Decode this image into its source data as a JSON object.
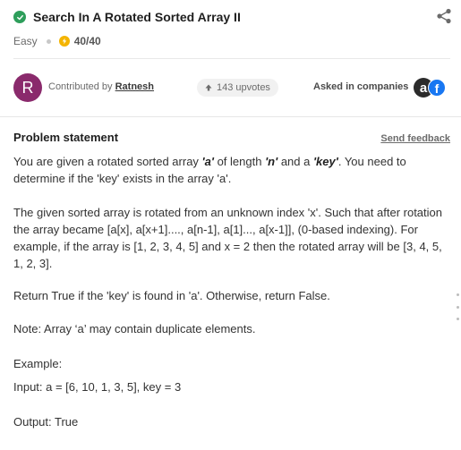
{
  "problem": {
    "title": "Search In A Rotated Sorted Array II",
    "difficulty": "Easy",
    "score": "40/40"
  },
  "contributor": {
    "avatar_letter": "R",
    "prefix": "Contributed by",
    "name": "Ratnesh",
    "upvotes": "143 upvotes"
  },
  "companies": {
    "label": "Asked in companies",
    "logos": [
      "a",
      "f"
    ]
  },
  "statement": {
    "title": "Problem statement",
    "feedback_label": "Send feedback",
    "p1": {
      "t1": "You are given a rotated sorted array ",
      "a": "'a'",
      "t2": " of length ",
      "n": "'n'",
      "t3": " and a ",
      "key": "'key'",
      "t4": ". You need to determine if the 'key' exists in the array 'a'."
    },
    "p2": "The given sorted array is rotated from an unknown index 'x'. Such that after rotation the array became [a[x], a[x+1]...., a[n-1], a[1]..., a[x-1]], (0-based indexing). For example, if the array is [1, 2, 3, 4, 5] and x = 2 then the rotated array will be [3, 4, 5, 1, 2, 3].",
    "p3": "Return True if the 'key' is found in 'a'. Otherwise, return False.",
    "p4": "Note: Array ‘a’ may contain duplicate elements.",
    "example_label": "Example:",
    "example_input": "Input: a = [6, 10, 1, 3, 5], key = 3",
    "example_output": "Output: True"
  },
  "icons": {
    "solved": "check-circle-icon",
    "share": "share-icon",
    "score": "bolt-icon",
    "upvote": "arrow-up-icon"
  },
  "colors": {
    "solved": "#2e9e5b",
    "score": "#f4b400",
    "avatar": "#8a2a6c",
    "facebook": "#1877f2"
  }
}
